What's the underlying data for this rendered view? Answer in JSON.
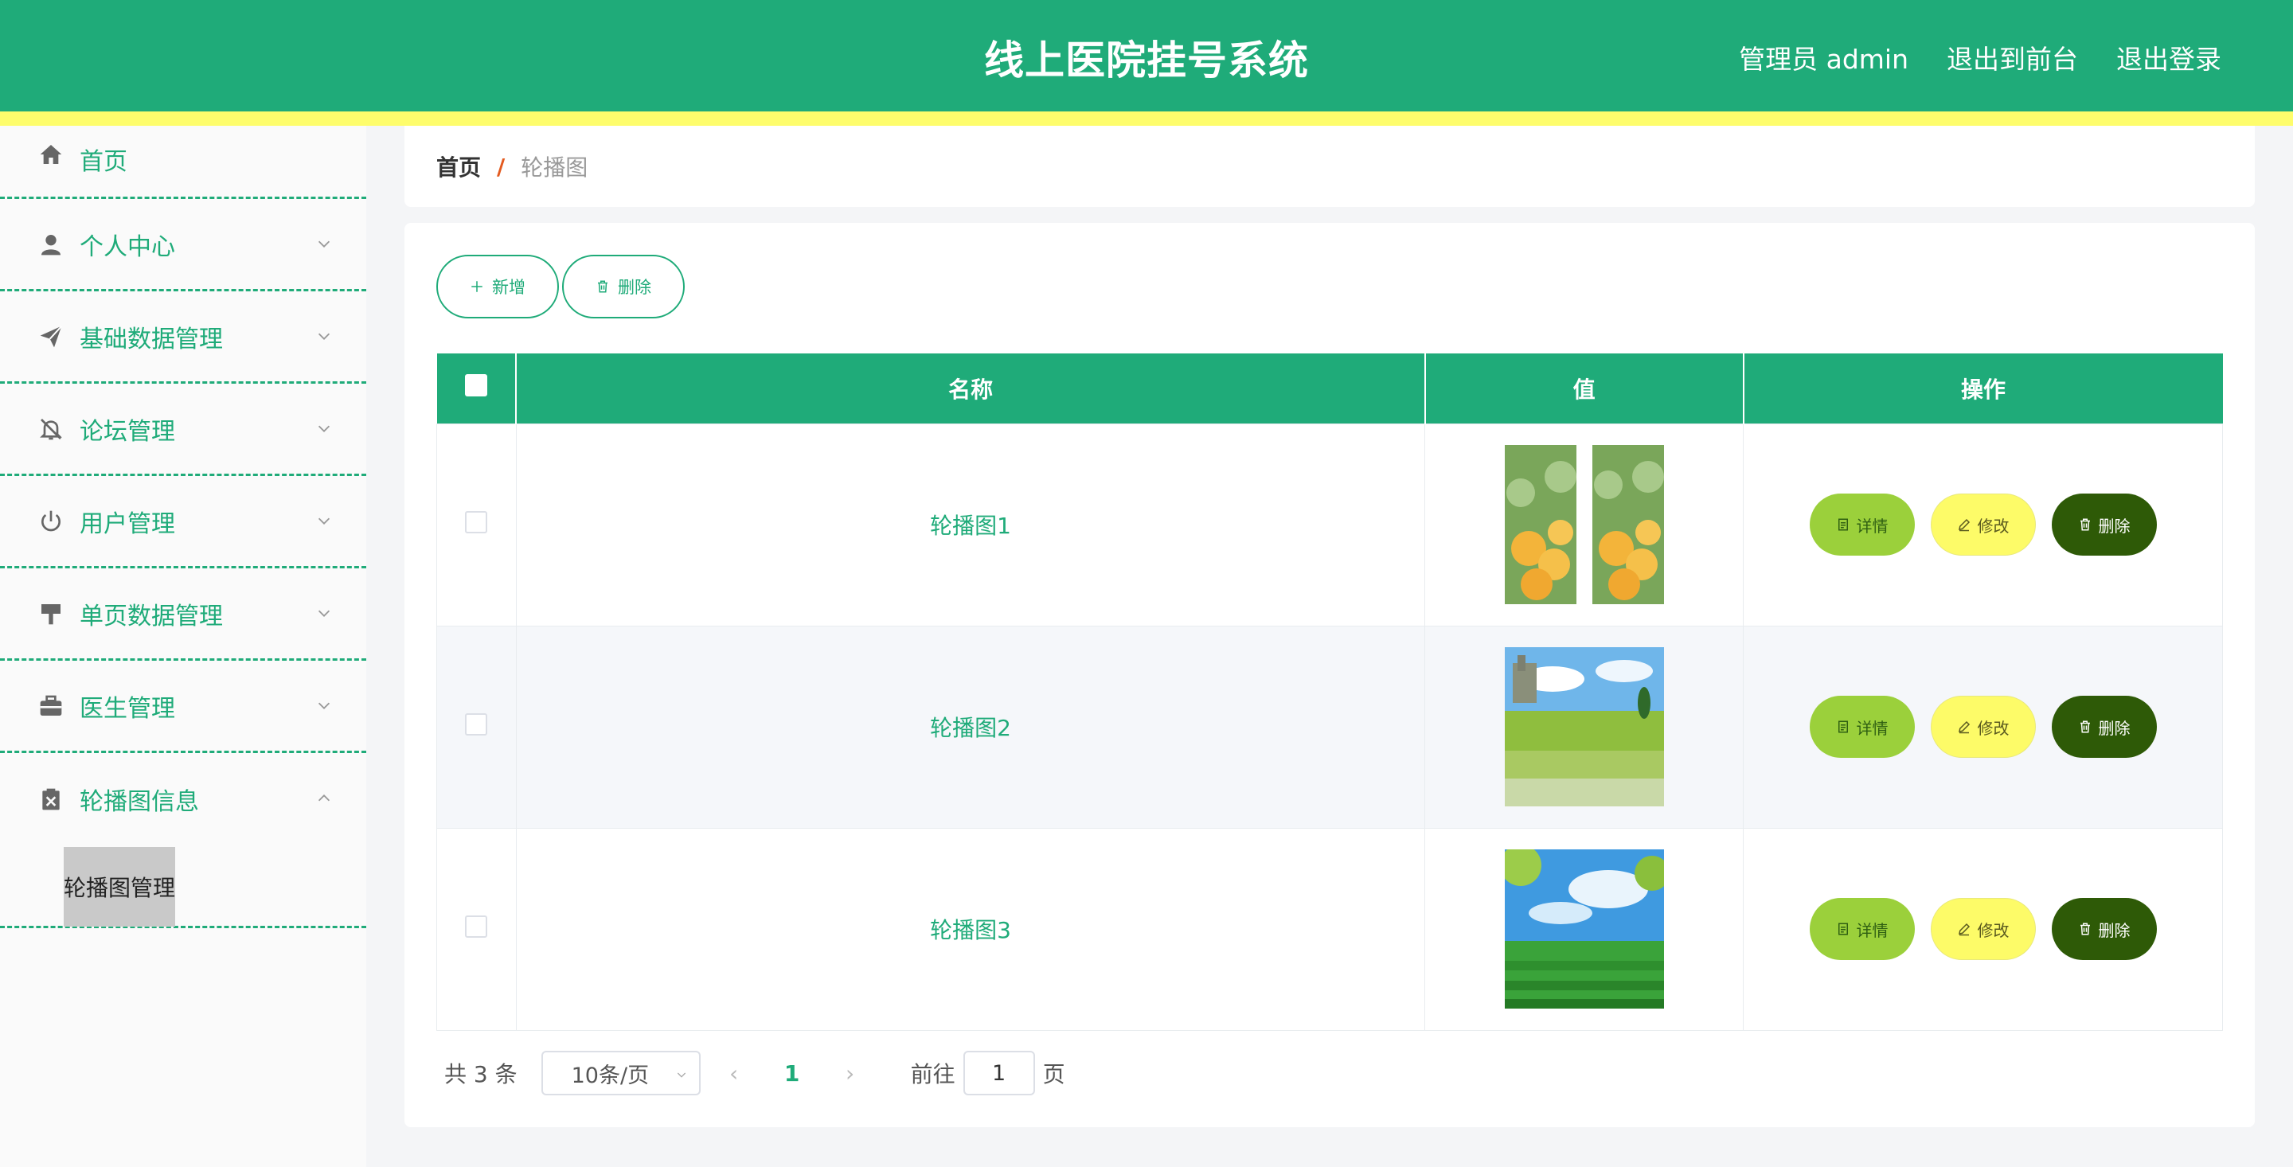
{
  "header": {
    "title": "线上医院挂号系统",
    "user_label": "管理员 admin",
    "back_to_front": "退出到前台",
    "logout": "退出登录"
  },
  "sidebar": {
    "items": [
      {
        "label": "首页",
        "icon": "home-icon"
      },
      {
        "label": "个人中心",
        "icon": "user-icon"
      },
      {
        "label": "基础数据管理",
        "icon": "send-icon"
      },
      {
        "label": "论坛管理",
        "icon": "bell-off-icon"
      },
      {
        "label": "用户管理",
        "icon": "power-icon"
      },
      {
        "label": "单页数据管理",
        "icon": "brush-icon"
      },
      {
        "label": "医生管理",
        "icon": "briefcase-icon"
      },
      {
        "label": "轮播图信息",
        "icon": "clipboard-icon"
      }
    ],
    "submenu_label": "轮播图管理"
  },
  "breadcrumb": {
    "home": "首页",
    "separator": "/",
    "current": "轮播图"
  },
  "toolbar": {
    "add_label": "新增",
    "delete_label": "删除"
  },
  "table": {
    "headers": [
      "名称",
      "值",
      "操作"
    ],
    "rows": [
      {
        "name": "轮播图1",
        "image": "yellow-roses"
      },
      {
        "name": "轮播图2",
        "image": "green-meadow"
      },
      {
        "name": "轮播图3",
        "image": "green-field-sky"
      }
    ],
    "actions": {
      "detail": "详情",
      "edit": "修改",
      "delete": "删除"
    }
  },
  "pagination": {
    "total": "共 3 条",
    "page_size": "10条/页",
    "current_page": "1",
    "goto_label": "前往",
    "goto_value": "1",
    "page_suffix": "页"
  },
  "colors": {
    "primary": "#1fab79",
    "accent_band": "#fefd6c",
    "detail_btn": "#9bd03b",
    "edit_btn": "#fdfb68",
    "delete_btn": "#2e5a07"
  }
}
